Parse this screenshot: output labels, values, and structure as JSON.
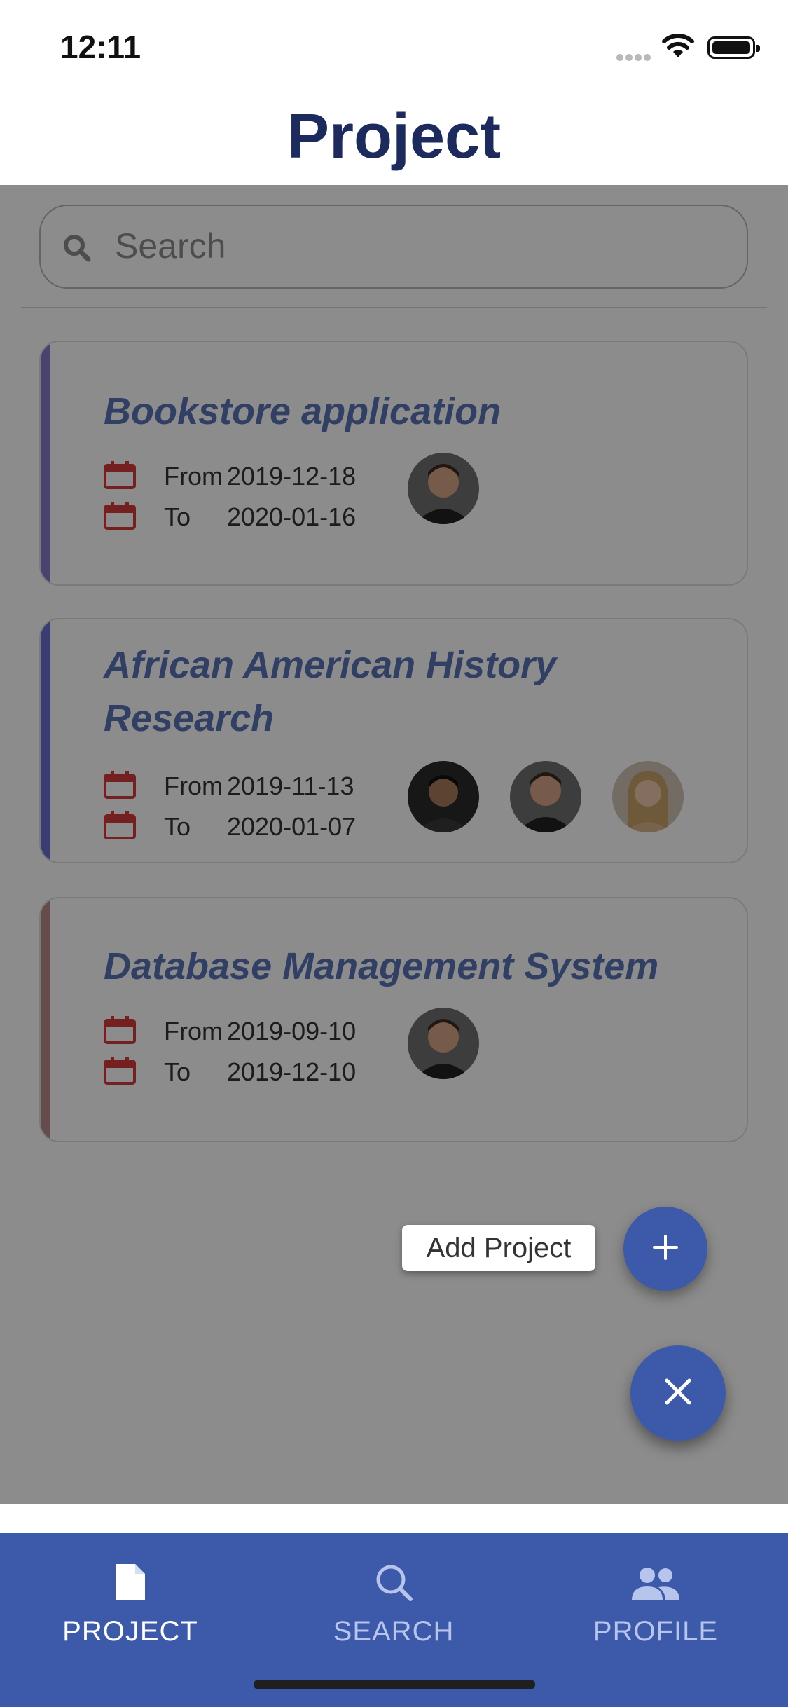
{
  "status_bar": {
    "time": "12:11"
  },
  "header": {
    "title": "Project"
  },
  "search": {
    "placeholder": "Search"
  },
  "projects": [
    {
      "title_lines": [
        "Bookstore application"
      ],
      "stripe_color": "#8b78c8",
      "from_label": "From",
      "from_date": "2019-12-18",
      "to_label": "To",
      "to_date": "2020-01-16",
      "members": [
        "man-smiling-avatar"
      ]
    },
    {
      "title_lines": [
        "African American History",
        "Research"
      ],
      "stripe_color": "#6a6ed0",
      "from_label": "From",
      "from_date": "2019-11-13",
      "to_label": "To",
      "to_date": "2020-01-07",
      "members": [
        "man-dark-hair-avatar",
        "man-smiling-avatar",
        "woman-blonde-avatar"
      ]
    },
    {
      "title_lines": [
        "Database Management System"
      ],
      "stripe_color": "#b88a8a",
      "from_label": "From",
      "from_date": "2019-09-10",
      "to_label": "To",
      "to_date": "2019-12-10",
      "members": [
        "man-smiling-avatar"
      ]
    }
  ],
  "fab": {
    "add_tooltip": "Add Project",
    "add_icon": "plus-icon",
    "close_icon": "close-icon"
  },
  "tabbar": {
    "tabs": [
      {
        "label": "PROJECT",
        "icon": "document-icon",
        "active": true
      },
      {
        "label": "SEARCH",
        "icon": "search-icon",
        "active": false
      },
      {
        "label": "PROFILE",
        "icon": "people-icon",
        "active": false
      }
    ]
  },
  "colors": {
    "header_title": "#1c2a5e",
    "card_title": "#5a73b8",
    "calendar": "#d63b3b",
    "primary": "#3d59aa"
  }
}
